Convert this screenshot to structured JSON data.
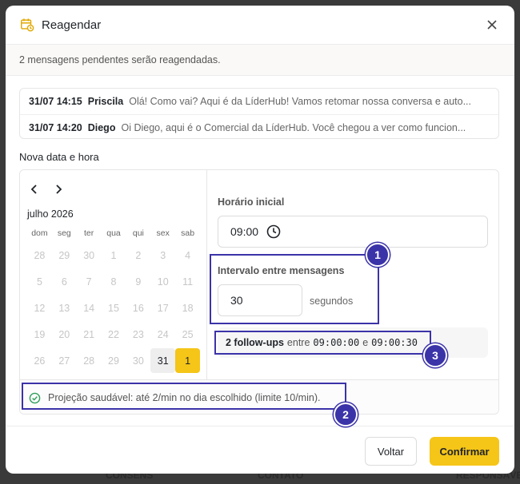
{
  "dialog": {
    "title": "Reagendar",
    "subtitle": "2 mensagens pendentes serão reagendadas."
  },
  "messages": [
    {
      "time": "31/07 14:15",
      "name": "Priscila",
      "text": "Olá! Como vai? Aqui é da LíderHub! Vamos retomar nossa conversa e auto..."
    },
    {
      "time": "31/07 14:20",
      "name": "Diego",
      "text": "Oi Diego, aqui é o Comercial da LíderHub. Você chegou a ver como funcion..."
    }
  ],
  "schedule": {
    "section_label": "Nova data e hora",
    "calendar": {
      "month_label": "julho 2026",
      "weekdays": [
        "dom",
        "seg",
        "ter",
        "qua",
        "qui",
        "sex",
        "sab"
      ],
      "weeks": [
        [
          "28",
          "29",
          "30",
          "1",
          "2",
          "3",
          "4"
        ],
        [
          "5",
          "6",
          "7",
          "8",
          "9",
          "10",
          "11"
        ],
        [
          "12",
          "13",
          "14",
          "15",
          "16",
          "17",
          "18"
        ],
        [
          "19",
          "20",
          "21",
          "22",
          "23",
          "24",
          "25"
        ],
        [
          "26",
          "27",
          "28",
          "29",
          "30",
          "31",
          "1"
        ]
      ],
      "today": "31",
      "selected": "1"
    },
    "start_time_label": "Horário inicial",
    "start_time_value": "09:00",
    "interval_label": "Intervalo entre mensagens",
    "interval_value": "30",
    "interval_unit": "segundos",
    "followups": {
      "count_label": "2 follow-ups",
      "between": "entre",
      "start": "09:00:00",
      "and": "e",
      "end": "09:00:30"
    },
    "health_text": "Projeção saudável: até 2/min no dia escolhido (limite 10/min)."
  },
  "footer": {
    "back_label": "Voltar",
    "confirm_label": "Confirmar"
  },
  "annotations": [
    "1",
    "2",
    "3"
  ],
  "backdrop": [
    "CONSENS",
    "CONTATO",
    "RESPONSÁVEL"
  ],
  "colors": {
    "accent": "#f5c518",
    "annotation": "#3b33a8",
    "health_ok": "#2e9e5b"
  }
}
